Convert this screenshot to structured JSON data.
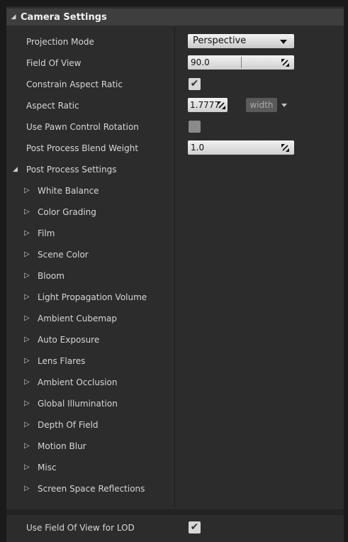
{
  "category": {
    "title": "Camera Settings"
  },
  "properties": {
    "projection_mode": {
      "label": "Projection Mode",
      "value": "Perspective"
    },
    "field_of_view": {
      "label": "Field Of View",
      "value": "90.0"
    },
    "constrain_aspect": {
      "label": "Constrain Aspect Ratic",
      "checked": true
    },
    "aspect_ratio": {
      "label": "Aspect Ratic",
      "value": "1.7777",
      "preset": "width"
    },
    "use_pawn": {
      "label": "Use Pawn Control Rotation",
      "checked": false
    },
    "blend_weight": {
      "label": "Post Process Blend Weight",
      "value": "1.0"
    }
  },
  "post_process": {
    "label": "Post Process Settings",
    "items": [
      "White Balance",
      "Color Grading",
      "Film",
      "Scene Color",
      "Bloom",
      "Light Propagation Volume",
      "Ambient Cubemap",
      "Auto Exposure",
      "Lens Flares",
      "Ambient Occlusion",
      "Global Illumination",
      "Depth Of Field",
      "Motion Blur",
      "Misc",
      "Screen Space Reflections"
    ]
  },
  "bottom": {
    "label": "Use Field Of View for LOD",
    "checked": true
  },
  "icons": {
    "expanded": "triangle-expanded-icon",
    "collapsed": "triangle-collapsed-icon",
    "check": "checkmark-icon",
    "drag": "drag-handle-icon",
    "dropdown": "chevron-down-icon"
  },
  "colors": {
    "panel": "#2c2c2c",
    "header": "#3e3e3e",
    "field": "#e6e6e6"
  }
}
